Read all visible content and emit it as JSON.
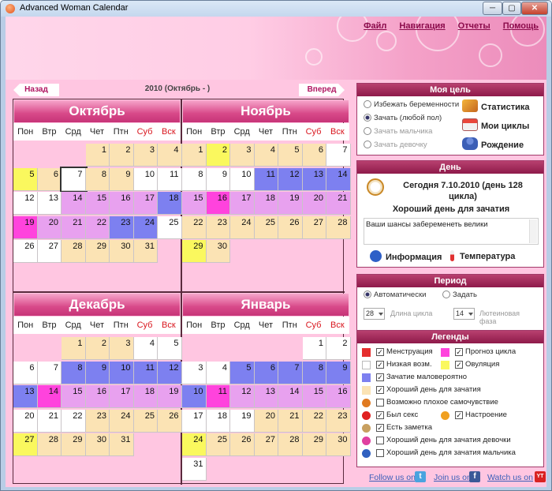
{
  "window": {
    "title": "Advanced Woman Calendar",
    "min_glyph": "─",
    "max_glyph": "▢",
    "close_glyph": "✕"
  },
  "menu": {
    "items": [
      "Файл",
      "Навигация",
      "Отчеты",
      "Помощь"
    ]
  },
  "nav": {
    "prev": "Назад",
    "title": "2010 (Октябрь - )",
    "next": "Вперед"
  },
  "colors": {
    "menstruation": "#e52d2d",
    "low": "#ffffff",
    "unlikely": "#7d80f0",
    "good": "#fbe3b4",
    "forecast": "#ff43dd",
    "ovulation": "#faf85e",
    "light_violet": "#e8a1ef",
    "blank": "#ffc6e1"
  },
  "weekdays": [
    "Пон",
    "Втр",
    "Срд",
    "Чет",
    "Птн",
    "Суб",
    "Вск"
  ],
  "months": [
    {
      "name": "Октябрь",
      "offset": 3,
      "days": 31,
      "selected": 7,
      "colors": [
        "G",
        "G",
        "G",
        "G",
        "Y",
        "G",
        "W",
        "G",
        "G",
        "W",
        "W",
        "W",
        "W",
        "V",
        "V",
        "V",
        "V",
        "B",
        "F",
        "V",
        "P",
        "P",
        "B",
        "B",
        "W",
        "W",
        "W",
        "G",
        "G",
        "G",
        "G"
      ]
    },
    {
      "name": "Ноябрь",
      "offset": 0,
      "days": 30,
      "selected": null,
      "colors": [
        "G",
        "Y",
        "G",
        "G",
        "G",
        "G",
        "W",
        "W",
        "W",
        "W",
        "B",
        "B",
        "B",
        "B",
        "V",
        "F",
        "V",
        "V",
        "V",
        "V",
        "P",
        "G",
        "G",
        "G",
        "G",
        "G",
        "G",
        "G",
        "Y",
        "G"
      ]
    },
    {
      "name": "Декабрь",
      "offset": 2,
      "days": 31,
      "selected": null,
      "colors": [
        "G",
        "G",
        "G",
        "W",
        "W",
        "W",
        "W",
        "B",
        "B",
        "B",
        "B",
        "B",
        "B",
        "F",
        "V",
        "V",
        "V",
        "V",
        "V",
        "W",
        "W",
        "W",
        "G",
        "G",
        "G",
        "G",
        "Y",
        "G",
        "G",
        "G",
        "G"
      ]
    },
    {
      "name": "Январь",
      "offset": 5,
      "days": 31,
      "selected": null,
      "colors": [
        "W",
        "W",
        "W",
        "W",
        "B",
        "B",
        "B",
        "B",
        "B",
        "B",
        "F",
        "V",
        "V",
        "V",
        "V",
        "V",
        "W",
        "W",
        "W",
        "G",
        "G",
        "G",
        "G",
        "Y",
        "G",
        "G",
        "G",
        "G",
        "G",
        "G",
        "W"
      ]
    }
  ],
  "goal": {
    "header": "Моя цель",
    "options": [
      {
        "label": "Избежать беременности",
        "checked": false,
        "disabled": false
      },
      {
        "label": "Зачать (любой пол)",
        "checked": true,
        "disabled": false
      },
      {
        "label": "Зачать мальчика",
        "checked": false,
        "disabled": true
      },
      {
        "label": "Зачать девочку",
        "checked": false,
        "disabled": true
      }
    ],
    "buttons": [
      "Статистика",
      "Мои циклы",
      "Рождение"
    ]
  },
  "day": {
    "header": "День",
    "date_line1": "Сегодня 7.10.2010 (день 128",
    "date_line2": "цикла)",
    "verdict": "Хороший день для зачатия",
    "text": "Ваши шансы забеременеть велики",
    "info_button": "Информация",
    "temp_button": "Температура"
  },
  "period": {
    "header": "Период",
    "auto": "Автоматически",
    "set": "Задать",
    "cycle_value": "28",
    "cycle_label": "Длина цикла",
    "luteal_value": "14",
    "luteal_label1": "Лютеиновая",
    "luteal_label2": "фаза"
  },
  "legend": {
    "header": "Легенды",
    "items": [
      {
        "label": "Менструация",
        "checked": true
      },
      {
        "label": "Прогноз цикла",
        "checked": true
      },
      {
        "label": "Низкая возм.",
        "checked": true
      },
      {
        "label": "Овуляция",
        "checked": true
      },
      {
        "label": "Зачатие маловероятно",
        "checked": true
      },
      {
        "label": "Хороший день для зачатия",
        "checked": true
      },
      {
        "label": "Возможно плохое самочувствие",
        "checked": false
      },
      {
        "label": "Был секс",
        "checked": true
      },
      {
        "label": "Настроение",
        "checked": true
      },
      {
        "label": "Есть заметка",
        "checked": true
      },
      {
        "label": "Хороший день для зачатия девочки",
        "checked": false
      },
      {
        "label": "Хороший день для зачатия мальчика",
        "checked": false
      }
    ]
  },
  "footer": {
    "follow": "Follow us on",
    "join": "Join us on",
    "watch": "Watch us on"
  }
}
